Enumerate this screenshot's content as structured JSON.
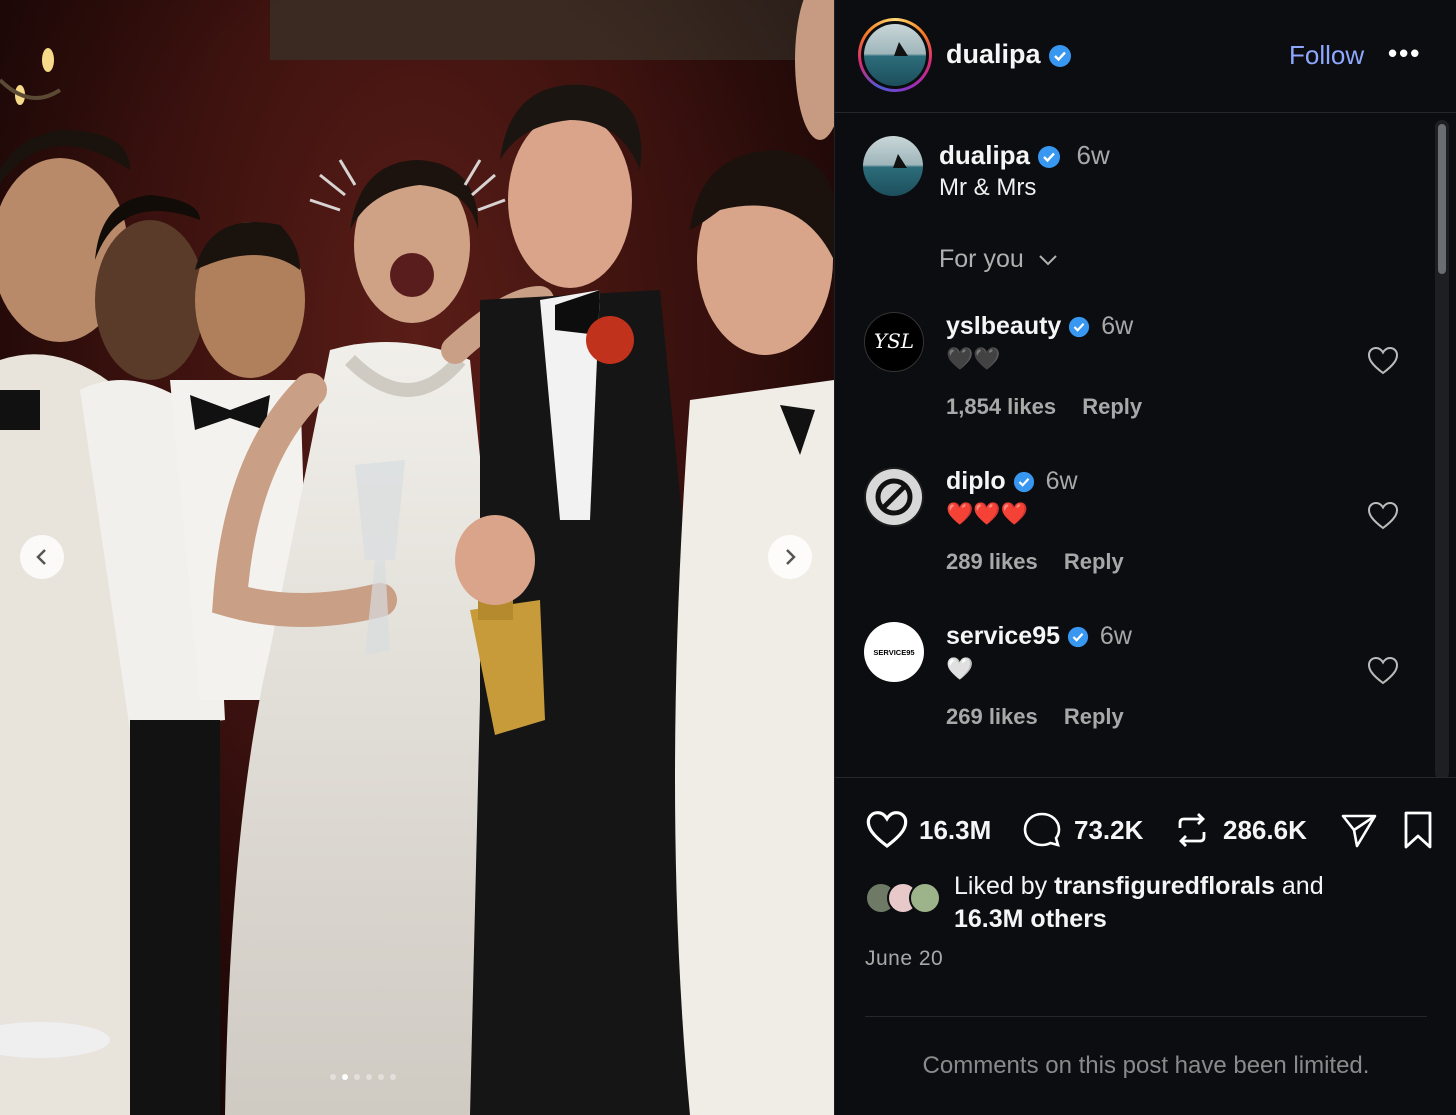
{
  "post": {
    "author": "dualipa",
    "follow_label": "Follow",
    "more_label": "•••",
    "caption_user": "dualipa",
    "caption_time": "6w",
    "caption_text": "Mr & Mrs",
    "comment_filter": "For you",
    "carousel": {
      "slide_count": 6,
      "active_index": 1
    }
  },
  "comments": [
    {
      "user": "yslbeauty",
      "time": "6w",
      "text": "🖤🖤",
      "likes": "1,854 likes",
      "reply": "Reply",
      "avatar_text": "YSL"
    },
    {
      "user": "diplo",
      "time": "6w",
      "text": "❤️❤️❤️",
      "likes": "289 likes",
      "reply": "Reply",
      "avatar_text": "Ø"
    },
    {
      "user": "service95",
      "time": "6w",
      "text": "🤍",
      "likes": "269 likes",
      "reply": "Reply",
      "avatar_text": "SERVICE95"
    }
  ],
  "actions": {
    "likes": "16.3M",
    "comments": "73.2K",
    "reposts": "286.6K"
  },
  "liked_by": {
    "prefix": "Liked by ",
    "user": "transfiguredflorals",
    "middle": " and",
    "others": "16.3M others"
  },
  "date": "June 20",
  "limited_notice": "Comments on this post have been limited.",
  "colors": {
    "panel_bg": "#0b0d10",
    "follow": "#8fa8ff",
    "verified": "#3897f0",
    "muted": "#a8a8a8"
  }
}
